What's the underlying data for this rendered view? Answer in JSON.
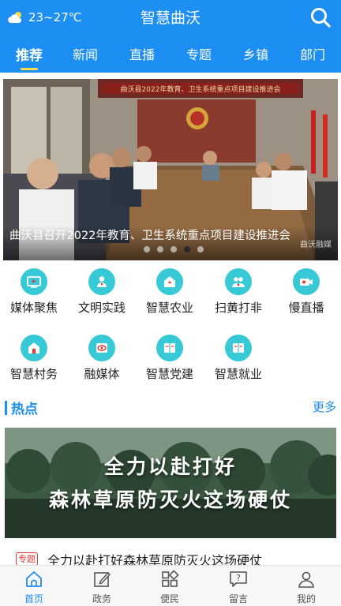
{
  "header": {
    "weather_text": "23~27℃",
    "title": "智慧曲沃"
  },
  "tabs": [
    {
      "label": "推荐",
      "active": true
    },
    {
      "label": "新闻"
    },
    {
      "label": "直播"
    },
    {
      "label": "专题"
    },
    {
      "label": "乡镇"
    },
    {
      "label": "部门"
    }
  ],
  "banner": {
    "caption": "曲沃县召开2022年教育、卫生系统重点项目建设推进会",
    "watermark": "曲沃融媒",
    "slide_count": 5,
    "active_slide": 4
  },
  "grid": [
    {
      "label": "媒体聚焦",
      "icon": "tv-icon"
    },
    {
      "label": "文明实践",
      "icon": "person-icon"
    },
    {
      "label": "智慧农业",
      "icon": "farm-house-icon"
    },
    {
      "label": "扫黄打非",
      "icon": "people-icon"
    },
    {
      "label": "慢直播",
      "icon": "camera-icon"
    },
    {
      "label": "智慧村务",
      "icon": "house-icon"
    },
    {
      "label": "融媒体",
      "icon": "eye-icon"
    },
    {
      "label": "智慧党建",
      "icon": "book-icon"
    },
    {
      "label": "智慧就业",
      "icon": "book-icon"
    }
  ],
  "hot": {
    "title": "热点",
    "more": "更多",
    "image_lines": [
      "全力以赴打好",
      "森林草原防灭火这场硬仗"
    ],
    "item_tag": "专题",
    "item_title": "全力以赴打好森林草原防灭火这场硬仗"
  },
  "bottom_nav": [
    {
      "label": "首页",
      "icon": "home-icon",
      "active": true
    },
    {
      "label": "政务",
      "icon": "edit-icon"
    },
    {
      "label": "便民",
      "icon": "grid-icon"
    },
    {
      "label": "留言",
      "icon": "message-icon"
    },
    {
      "label": "我的",
      "icon": "user-icon"
    }
  ],
  "colors": {
    "primary": "#1d8ef2",
    "icon_bg": "#38c9d6",
    "tab_indicator": "#ffd84a",
    "tag_red": "#e53935"
  }
}
